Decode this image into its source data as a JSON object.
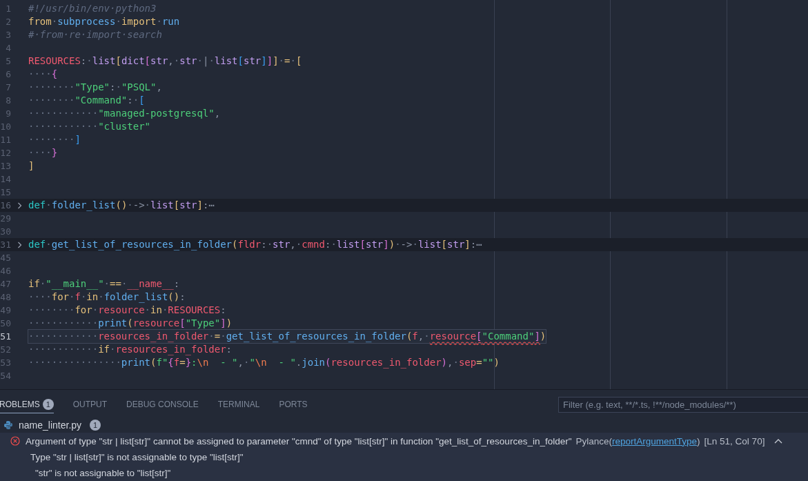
{
  "editor": {
    "lines": [
      {
        "number": "1",
        "folded": false,
        "current": false,
        "tokens": [
          {
            "kind": "cmt",
            "text": "#!/usr/bin/env·python3"
          }
        ]
      },
      {
        "number": "2",
        "folded": false,
        "current": false,
        "tokens": [
          {
            "kind": "kw",
            "text": "from"
          },
          {
            "kind": "ws",
            "text": "·"
          },
          {
            "kind": "mod",
            "text": "subprocess"
          },
          {
            "kind": "ws",
            "text": "·"
          },
          {
            "kind": "kw",
            "text": "import"
          },
          {
            "kind": "ws",
            "text": "·"
          },
          {
            "kind": "fn",
            "text": "run"
          }
        ]
      },
      {
        "number": "3",
        "folded": false,
        "current": false,
        "tokens": [
          {
            "kind": "cmt",
            "text": "#·from·re·import·search"
          }
        ]
      },
      {
        "number": "4",
        "folded": false,
        "current": false
      },
      {
        "number": "5",
        "folded": false,
        "current": false,
        "tokens": [
          {
            "kind": "var",
            "text": "RESOURCES"
          },
          {
            "kind": "punc",
            "text": ":"
          },
          {
            "kind": "ws",
            "text": "·"
          },
          {
            "kind": "type",
            "text": "list"
          },
          {
            "kind": "br1",
            "text": "["
          },
          {
            "kind": "type",
            "text": "dict"
          },
          {
            "kind": "br2",
            "text": "["
          },
          {
            "kind": "type",
            "text": "str"
          },
          {
            "kind": "punc",
            "text": ","
          },
          {
            "kind": "ws",
            "text": "·"
          },
          {
            "kind": "type",
            "text": "str"
          },
          {
            "kind": "ws",
            "text": "·"
          },
          {
            "kind": "punc",
            "text": "|"
          },
          {
            "kind": "ws",
            "text": "·"
          },
          {
            "kind": "type",
            "text": "list"
          },
          {
            "kind": "br3",
            "text": "["
          },
          {
            "kind": "type",
            "text": "str"
          },
          {
            "kind": "br3",
            "text": "]"
          },
          {
            "kind": "br2",
            "text": "]"
          },
          {
            "kind": "br1",
            "text": "]"
          },
          {
            "kind": "ws",
            "text": "·"
          },
          {
            "kind": "op",
            "text": "="
          },
          {
            "kind": "ws",
            "text": "·"
          },
          {
            "kind": "br1",
            "text": "["
          }
        ]
      },
      {
        "number": "6",
        "folded": false,
        "current": false,
        "tokens": [
          {
            "kind": "ws",
            "text": "····"
          },
          {
            "kind": "br2",
            "text": "{"
          }
        ]
      },
      {
        "number": "7",
        "folded": false,
        "current": false,
        "tokens": [
          {
            "kind": "ws",
            "text": "········"
          },
          {
            "kind": "str",
            "text": "\"Type\""
          },
          {
            "kind": "punc",
            "text": ":"
          },
          {
            "kind": "ws",
            "text": "·"
          },
          {
            "kind": "str",
            "text": "\"PSQL\""
          },
          {
            "kind": "punc",
            "text": ","
          }
        ]
      },
      {
        "number": "8",
        "folded": false,
        "current": false,
        "tokens": [
          {
            "kind": "ws",
            "text": "········"
          },
          {
            "kind": "str",
            "text": "\"Command\""
          },
          {
            "kind": "punc",
            "text": ":"
          },
          {
            "kind": "ws",
            "text": "·"
          },
          {
            "kind": "br3",
            "text": "["
          }
        ]
      },
      {
        "number": "9",
        "folded": false,
        "current": false,
        "tokens": [
          {
            "kind": "ws",
            "text": "············"
          },
          {
            "kind": "str",
            "text": "\"managed-postgresql\""
          },
          {
            "kind": "punc",
            "text": ","
          }
        ]
      },
      {
        "number": "10",
        "folded": false,
        "current": false,
        "tokens": [
          {
            "kind": "ws",
            "text": "············"
          },
          {
            "kind": "str",
            "text": "\"cluster\""
          }
        ]
      },
      {
        "number": "11",
        "folded": false,
        "current": false,
        "tokens": [
          {
            "kind": "ws",
            "text": "········"
          },
          {
            "kind": "br3",
            "text": "]"
          }
        ]
      },
      {
        "number": "12",
        "folded": false,
        "current": false,
        "tokens": [
          {
            "kind": "ws",
            "text": "····"
          },
          {
            "kind": "br2",
            "text": "}"
          }
        ]
      },
      {
        "number": "13",
        "folded": false,
        "current": false,
        "tokens": [
          {
            "kind": "br1",
            "text": "]"
          }
        ]
      },
      {
        "number": "14",
        "folded": false,
        "current": false
      },
      {
        "number": "15",
        "folded": false,
        "current": false
      },
      {
        "number": "16",
        "folded": true,
        "current": false,
        "fold_text": "⋯",
        "tokens": [
          {
            "kind": "def",
            "text": "def"
          },
          {
            "kind": "ws",
            "text": "·"
          },
          {
            "kind": "fn",
            "text": "folder_list"
          },
          {
            "kind": "br1",
            "text": "()"
          },
          {
            "kind": "ws",
            "text": "·"
          },
          {
            "kind": "punc",
            "text": "->"
          },
          {
            "kind": "ws",
            "text": "·"
          },
          {
            "kind": "type",
            "text": "list"
          },
          {
            "kind": "br1",
            "text": "["
          },
          {
            "kind": "type",
            "text": "str"
          },
          {
            "kind": "br1",
            "text": "]"
          },
          {
            "kind": "punc",
            "text": ":"
          }
        ]
      },
      {
        "number": "29",
        "folded": false,
        "current": false
      },
      {
        "number": "30",
        "folded": false,
        "current": false
      },
      {
        "number": "31",
        "folded": true,
        "current": false,
        "fold_text": "⋯",
        "tokens": [
          {
            "kind": "def",
            "text": "def"
          },
          {
            "kind": "ws",
            "text": "·"
          },
          {
            "kind": "fn",
            "text": "get_list_of_resources_in_folder"
          },
          {
            "kind": "br1",
            "text": "("
          },
          {
            "kind": "var",
            "text": "fldr"
          },
          {
            "kind": "punc",
            "text": ":"
          },
          {
            "kind": "ws",
            "text": "·"
          },
          {
            "kind": "type",
            "text": "str"
          },
          {
            "kind": "punc",
            "text": ","
          },
          {
            "kind": "ws",
            "text": "·"
          },
          {
            "kind": "var",
            "text": "cmnd"
          },
          {
            "kind": "punc",
            "text": ":"
          },
          {
            "kind": "ws",
            "text": "·"
          },
          {
            "kind": "type",
            "text": "list"
          },
          {
            "kind": "br2",
            "text": "["
          },
          {
            "kind": "type",
            "text": "str"
          },
          {
            "kind": "br2",
            "text": "]"
          },
          {
            "kind": "br1",
            "text": ")"
          },
          {
            "kind": "ws",
            "text": "·"
          },
          {
            "kind": "punc",
            "text": "->"
          },
          {
            "kind": "ws",
            "text": "·"
          },
          {
            "kind": "type",
            "text": "list"
          },
          {
            "kind": "br1",
            "text": "["
          },
          {
            "kind": "type",
            "text": "str"
          },
          {
            "kind": "br1",
            "text": "]"
          },
          {
            "kind": "punc",
            "text": ":"
          }
        ]
      },
      {
        "number": "45",
        "folded": false,
        "current": false
      },
      {
        "number": "46",
        "folded": false,
        "current": false
      },
      {
        "number": "47",
        "folded": false,
        "current": false,
        "tokens": [
          {
            "kind": "kw",
            "text": "if"
          },
          {
            "kind": "ws",
            "text": "·"
          },
          {
            "kind": "str",
            "text": "\"__main__\""
          },
          {
            "kind": "ws",
            "text": "·"
          },
          {
            "kind": "op",
            "text": "=="
          },
          {
            "kind": "ws",
            "text": "·"
          },
          {
            "kind": "var",
            "text": "__name__"
          },
          {
            "kind": "punc",
            "text": ":"
          }
        ]
      },
      {
        "number": "48",
        "folded": false,
        "current": false,
        "tokens": [
          {
            "kind": "ws",
            "text": "····"
          },
          {
            "kind": "kw",
            "text": "for"
          },
          {
            "kind": "ws",
            "text": "·"
          },
          {
            "kind": "var",
            "text": "f"
          },
          {
            "kind": "ws",
            "text": "·"
          },
          {
            "kind": "kw",
            "text": "in"
          },
          {
            "kind": "ws",
            "text": "·"
          },
          {
            "kind": "fn",
            "text": "folder_list"
          },
          {
            "kind": "br1",
            "text": "()"
          },
          {
            "kind": "punc",
            "text": ":"
          }
        ]
      },
      {
        "number": "49",
        "folded": false,
        "current": false,
        "tokens": [
          {
            "kind": "ws",
            "text": "········"
          },
          {
            "kind": "kw",
            "text": "for"
          },
          {
            "kind": "ws",
            "text": "·"
          },
          {
            "kind": "var",
            "text": "resource"
          },
          {
            "kind": "ws",
            "text": "·"
          },
          {
            "kind": "kw",
            "text": "in"
          },
          {
            "kind": "ws",
            "text": "·"
          },
          {
            "kind": "var",
            "text": "RESOURCES"
          },
          {
            "kind": "punc",
            "text": ":"
          }
        ]
      },
      {
        "number": "50",
        "folded": false,
        "current": false,
        "tokens": [
          {
            "kind": "ws",
            "text": "············"
          },
          {
            "kind": "fn",
            "text": "print"
          },
          {
            "kind": "br1",
            "text": "("
          },
          {
            "kind": "var",
            "text": "resource"
          },
          {
            "kind": "br2",
            "text": "["
          },
          {
            "kind": "str",
            "text": "\"Type\""
          },
          {
            "kind": "br2",
            "text": "]"
          },
          {
            "kind": "br1",
            "text": ")"
          }
        ]
      },
      {
        "number": "51",
        "folded": false,
        "current": true,
        "tokens": [
          {
            "kind": "ws",
            "text": "············"
          },
          {
            "kind": "var",
            "text": "resources_in_folder"
          },
          {
            "kind": "ws",
            "text": "·"
          },
          {
            "kind": "op",
            "text": "="
          },
          {
            "kind": "ws",
            "text": "·"
          },
          {
            "kind": "fn",
            "text": "get_list_of_resources_in_folder"
          },
          {
            "kind": "br1",
            "text": "("
          },
          {
            "kind": "var",
            "text": "f"
          },
          {
            "kind": "punc",
            "text": ","
          },
          {
            "kind": "ws",
            "text": "·"
          },
          {
            "kind": "var",
            "text": "resource",
            "error": true
          },
          {
            "kind": "br2",
            "text": "[",
            "error": true
          },
          {
            "kind": "str",
            "text": "\"Command\"",
            "error": true
          },
          {
            "kind": "br2",
            "text": "]",
            "error": true
          },
          {
            "kind": "br1",
            "text": ")"
          }
        ]
      },
      {
        "number": "52",
        "folded": false,
        "current": false,
        "tokens": [
          {
            "kind": "ws",
            "text": "············"
          },
          {
            "kind": "kw",
            "text": "if"
          },
          {
            "kind": "ws",
            "text": "·"
          },
          {
            "kind": "var",
            "text": "resources_in_folder"
          },
          {
            "kind": "punc",
            "text": ":"
          }
        ]
      },
      {
        "number": "53",
        "folded": false,
        "current": false,
        "tokens": [
          {
            "kind": "ws",
            "text": "················"
          },
          {
            "kind": "fn",
            "text": "print"
          },
          {
            "kind": "br1",
            "text": "("
          },
          {
            "kind": "str",
            "text": "f\""
          },
          {
            "kind": "br2",
            "text": "{"
          },
          {
            "kind": "var",
            "text": "f"
          },
          {
            "kind": "op",
            "text": "="
          },
          {
            "kind": "br2",
            "text": "}"
          },
          {
            "kind": "str",
            "text": ":"
          },
          {
            "kind": "esc",
            "text": "\\n"
          },
          {
            "kind": "str",
            "text": "  - \""
          },
          {
            "kind": "punc",
            "text": ","
          },
          {
            "kind": "ws",
            "text": "·"
          },
          {
            "kind": "str",
            "text": "\""
          },
          {
            "kind": "esc",
            "text": "\\n"
          },
          {
            "kind": "str",
            "text": "  - \""
          },
          {
            "kind": "punc",
            "text": "."
          },
          {
            "kind": "fn",
            "text": "join"
          },
          {
            "kind": "br2",
            "text": "("
          },
          {
            "kind": "var",
            "text": "resources_in_folder"
          },
          {
            "kind": "br2",
            "text": ")"
          },
          {
            "kind": "punc",
            "text": ","
          },
          {
            "kind": "ws",
            "text": "·"
          },
          {
            "kind": "var",
            "text": "sep"
          },
          {
            "kind": "op",
            "text": "="
          },
          {
            "kind": "str",
            "text": "\"\""
          },
          {
            "kind": "br1",
            "text": ")"
          }
        ]
      },
      {
        "number": "54",
        "folded": false,
        "current": false
      }
    ]
  },
  "panel": {
    "tabs": [
      {
        "label": "ROBLEMS",
        "badge": "1",
        "selected": true
      },
      {
        "label": "OUTPUT",
        "selected": false
      },
      {
        "label": "DEBUG CONSOLE",
        "selected": false
      },
      {
        "label": "TERMINAL",
        "selected": false
      },
      {
        "label": "PORTS",
        "selected": false
      }
    ],
    "filter": {
      "placeholder": "Filter (e.g. text, **/*.ts, !**/node_modules/**)"
    },
    "file": {
      "name": "name_linter.py",
      "count": "1"
    },
    "problem": {
      "message": "Argument of type \"str | list[str]\" cannot be assigned to parameter \"cmnd\" of type \"list[str]\" in function \"get_list_of_resources_in_folder\"",
      "source": "Pylance",
      "open_paren": "(",
      "rule": "reportArgumentType",
      "close_paren": ")",
      "location": "[Ln 51, Col 70]",
      "selected": true,
      "details": [
        "Type \"str | list[str]\" is not assignable to type \"list[str]\"",
        "\"str\" is not assignable to \"list[str]\""
      ]
    }
  }
}
